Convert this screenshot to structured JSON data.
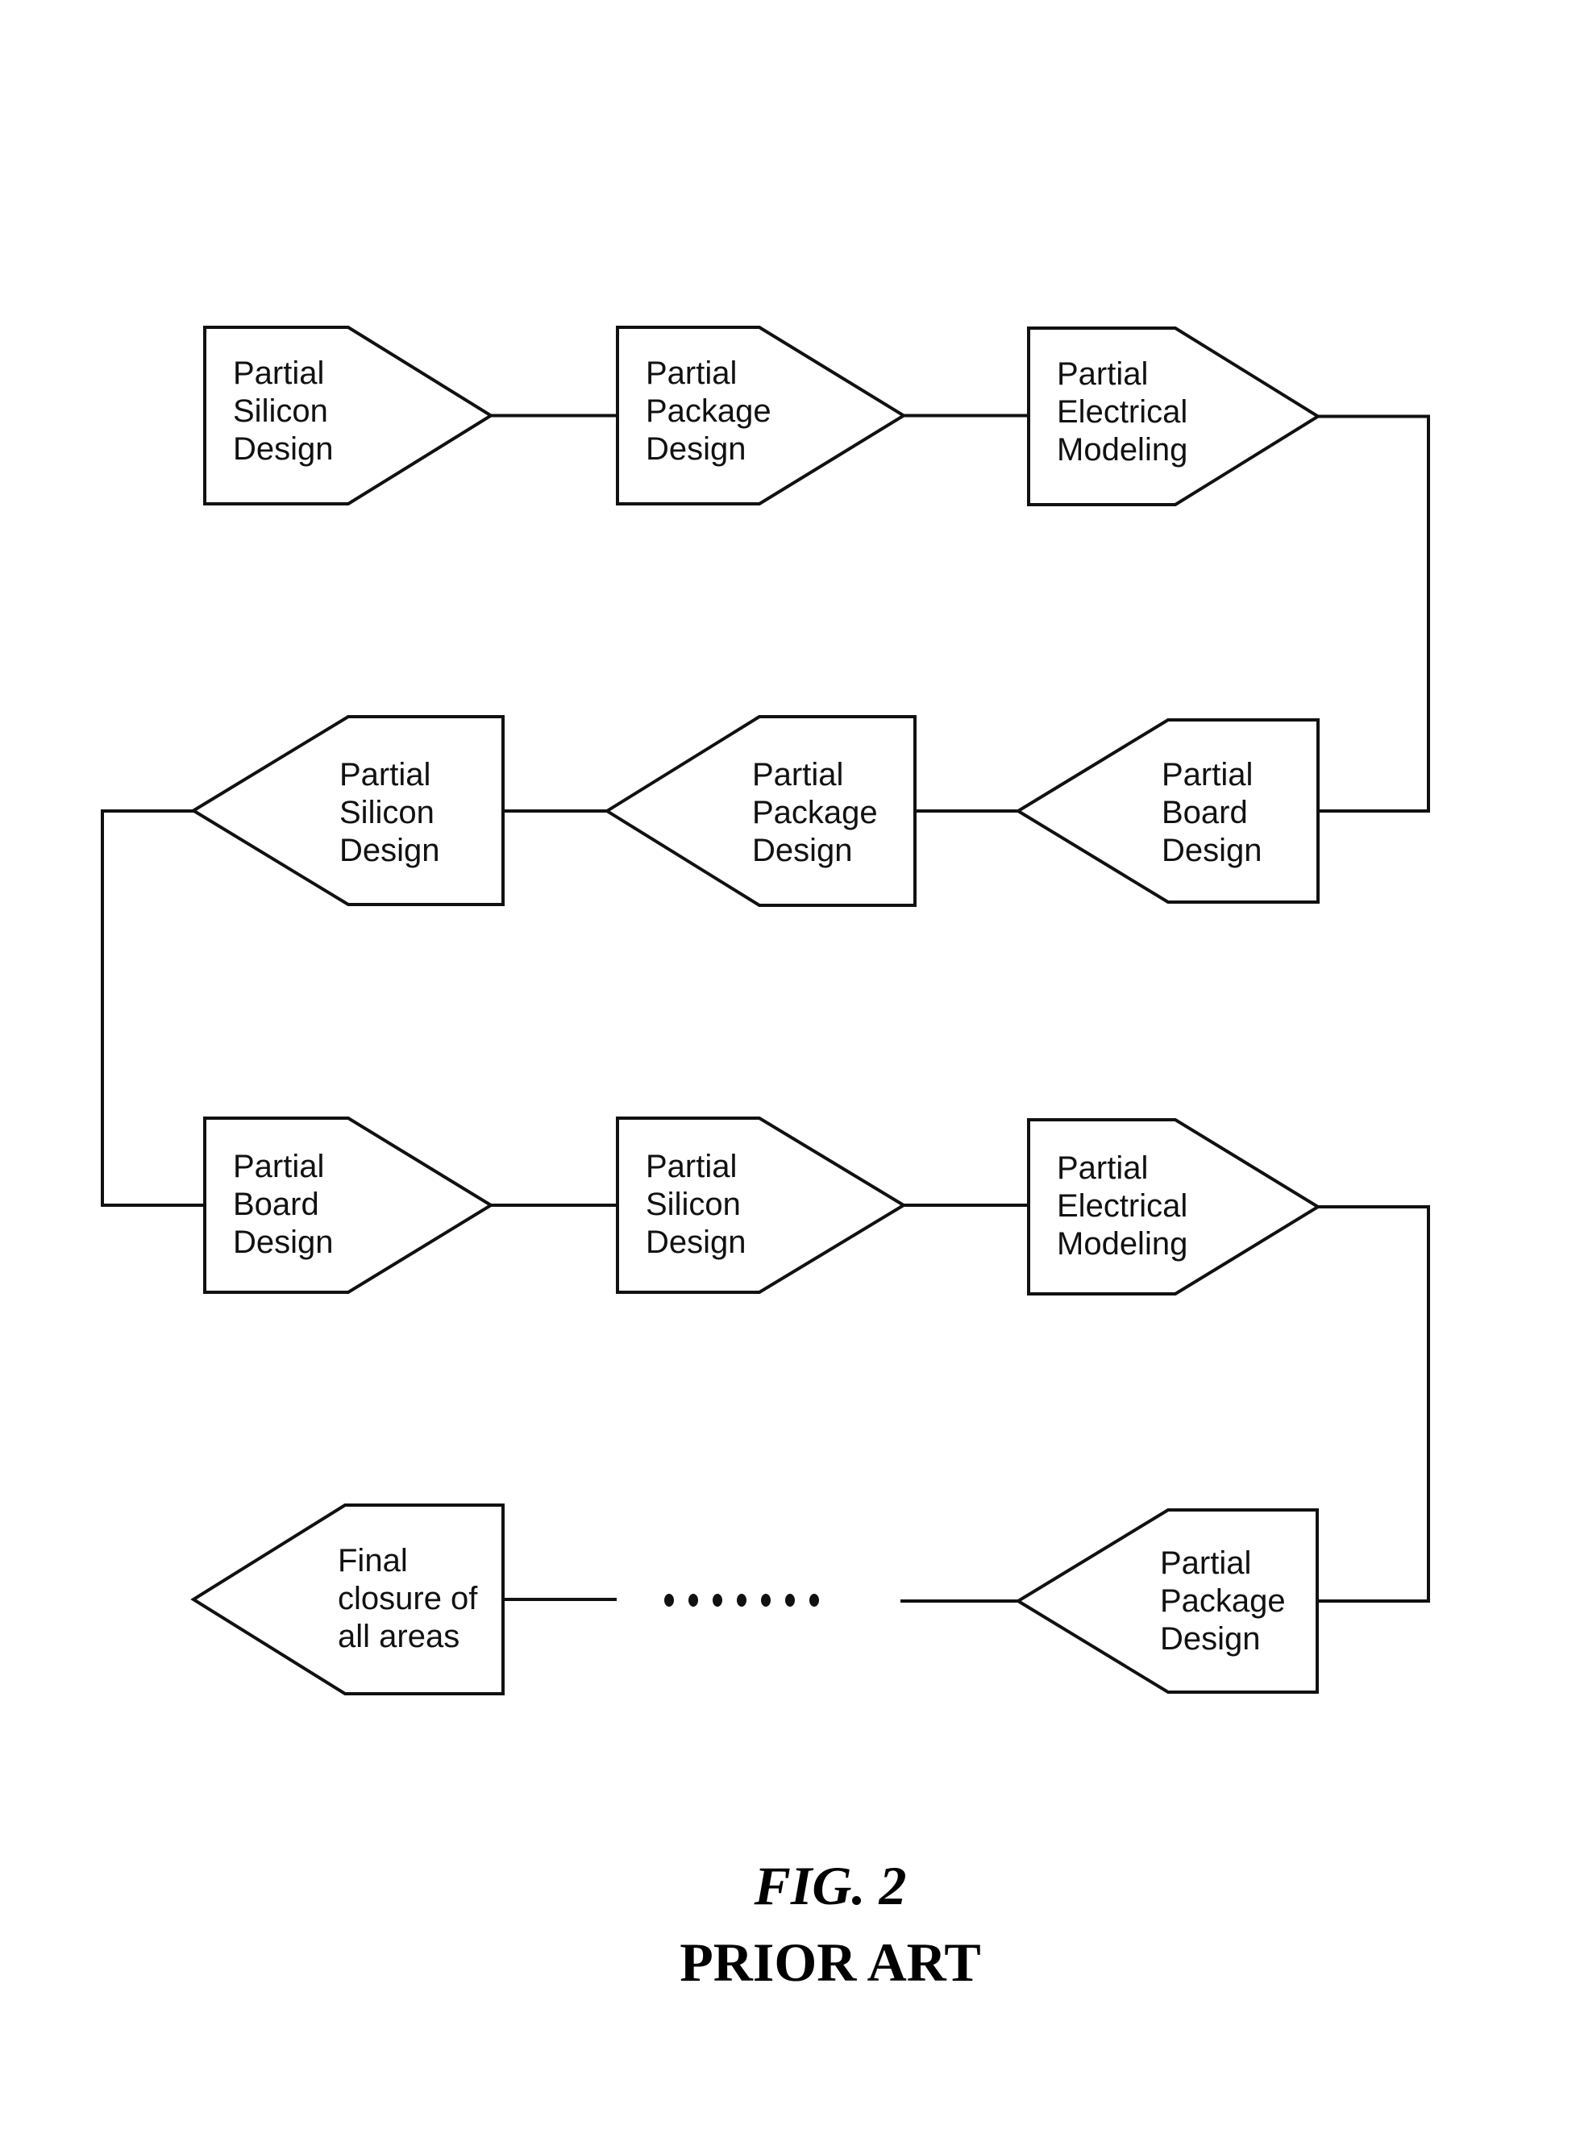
{
  "figure": {
    "caption": "FIG. 2",
    "subcaption": "PRIOR ART"
  },
  "nodes": [
    {
      "id": "n1",
      "label": "Partial\nSilicon\nDesign",
      "direction": "right"
    },
    {
      "id": "n2",
      "label": "Partial\nPackage\nDesign",
      "direction": "right"
    },
    {
      "id": "n3",
      "label": "Partial\nElectrical\nModeling",
      "direction": "right"
    },
    {
      "id": "n4",
      "label": "Partial\nBoard\nDesign",
      "direction": "left"
    },
    {
      "id": "n5",
      "label": "Partial\nPackage\nDesign",
      "direction": "left"
    },
    {
      "id": "n6",
      "label": "Partial\nSilicon\nDesign",
      "direction": "left"
    },
    {
      "id": "n7",
      "label": "Partial\nBoard\nDesign",
      "direction": "right"
    },
    {
      "id": "n8",
      "label": "Partial\nSilicon\nDesign",
      "direction": "right"
    },
    {
      "id": "n9",
      "label": "Partial\nElectrical\nModeling",
      "direction": "right"
    },
    {
      "id": "n10",
      "label": "Partial\nPackage\nDesign",
      "direction": "left"
    },
    {
      "id": "n11",
      "label": "Final\nclosure of\nall areas",
      "direction": "left"
    }
  ],
  "edges": [
    [
      "n1",
      "n2"
    ],
    [
      "n2",
      "n3"
    ],
    [
      "n3",
      "n4"
    ],
    [
      "n4",
      "n5"
    ],
    [
      "n5",
      "n6"
    ],
    [
      "n6",
      "n7"
    ],
    [
      "n7",
      "n8"
    ],
    [
      "n8",
      "n9"
    ],
    [
      "n9",
      "n10"
    ],
    [
      "n10",
      "ellipsis"
    ],
    [
      "ellipsis",
      "n11"
    ]
  ],
  "ellipsis": {
    "dots": 7
  }
}
